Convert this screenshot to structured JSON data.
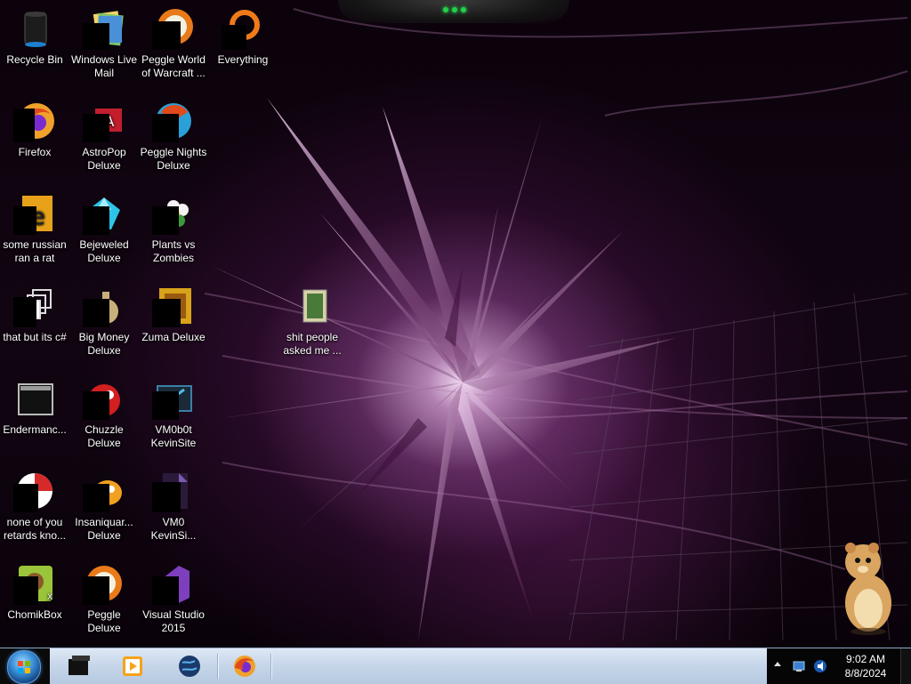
{
  "desktop": {
    "icons": [
      {
        "id": "recycle-bin",
        "label": "Recycle Bin"
      },
      {
        "id": "windows-live-mail",
        "label": "Windows Live\nMail"
      },
      {
        "id": "peggle-world-of-warcraft",
        "label": "Peggle World\nof Warcraft ..."
      },
      {
        "id": "everything",
        "label": "Everything"
      },
      {
        "id": "firefox",
        "label": "Firefox"
      },
      {
        "id": "astropop-deluxe",
        "label": "AstroPop\nDeluxe"
      },
      {
        "id": "peggle-nights-deluxe",
        "label": "Peggle Nights\nDeluxe"
      },
      {
        "id": "some-russian-ran-a-rat",
        "label": "some russian\nran a rat"
      },
      {
        "id": "bejeweled-deluxe",
        "label": "Bejeweled\nDeluxe"
      },
      {
        "id": "plants-vs-zombies",
        "label": "Plants vs\nZombies"
      },
      {
        "id": "that-but-its-csharp",
        "label": "that but its c#"
      },
      {
        "id": "big-money-deluxe",
        "label": "Big Money\nDeluxe"
      },
      {
        "id": "zuma-deluxe",
        "label": "Zuma Deluxe"
      },
      {
        "id": "endermanch",
        "label": "Endermanc..."
      },
      {
        "id": "chuzzle-deluxe",
        "label": "Chuzzle\nDeluxe"
      },
      {
        "id": "vm0b0t-kevinsite",
        "label": "VM0b0t\nKevinSite"
      },
      {
        "id": "none-of-you-retards",
        "label": "none of you\nretards kno..."
      },
      {
        "id": "insaniquarium-deluxe",
        "label": "Insaniquar...\nDeluxe"
      },
      {
        "id": "vm0-kevinsi",
        "label": "VM0\nKevinSi..."
      },
      {
        "id": "chomikbox",
        "label": "ChomikBox"
      },
      {
        "id": "peggle-deluxe",
        "label": "Peggle Deluxe"
      },
      {
        "id": "visual-studio-2015",
        "label": "Visual Studio\n2015"
      },
      {
        "id": "shit-people-asked-me",
        "label": "shit people\nasked me ..."
      }
    ]
  },
  "taskbar": {
    "start_label": "Start",
    "pinned": [
      {
        "name": "terminal-icon"
      },
      {
        "name": "media-player-icon"
      },
      {
        "name": "globe-icon"
      },
      {
        "name": "firefox-icon"
      }
    ],
    "tray": {
      "time": "9:02 AM",
      "date": "8/8/2024"
    }
  }
}
